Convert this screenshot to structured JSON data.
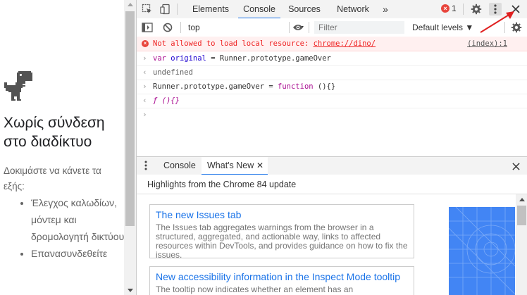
{
  "offline_page": {
    "title": "Χωρίς σύνδεση στο διαδίκτυο",
    "try_text": "Δοκιμάστε να κάνετε τα εξής:",
    "suggestions": [
      "Έλεγχος καλωδίων, μόντεμ και δρομολογητή δικτύου",
      "Επανασυνδεθείτε"
    ]
  },
  "devtools": {
    "tabs": [
      "Elements",
      "Console",
      "Sources",
      "Network"
    ],
    "active_tab": "Console",
    "more_tabs_icon": "»",
    "error_count": "1",
    "console_toolbar": {
      "context": "top",
      "filter_placeholder": "Filter",
      "levels": "Default levels ▼"
    },
    "messages": {
      "error_text": "Not allowed to load local resource: ",
      "error_link": "chrome://dino/",
      "error_source": "(index):1",
      "input1_kw": "var",
      "input1_name": "original",
      "input1_rest": " = Runner.prototype.gameOver",
      "output1": "undefined",
      "input2_start": "Runner.prototype.gameOver = ",
      "input2_kw": "function",
      "input2_end": " (){}",
      "output2_f": "ƒ",
      "output2_rest": " (){}"
    },
    "drawer": {
      "tabs": [
        "Console",
        "What's New"
      ],
      "active_tab": "What's New",
      "highlights": "Highlights from the Chrome 84 update",
      "cards": [
        {
          "title": "The new Issues tab",
          "description": "The Issues tab aggregates warnings from the browser in a structured, aggregated, and actionable way, links to affected resources within DevTools, and provides guidance on how to fix the issues."
        },
        {
          "title": "New accessibility information in the Inspect Mode tooltip",
          "description": "The tooltip now indicates whether an element has an"
        }
      ]
    },
    "colors": {
      "accent": "#1a73e8",
      "error": "#e8453c",
      "annotation": "#e02020"
    }
  }
}
